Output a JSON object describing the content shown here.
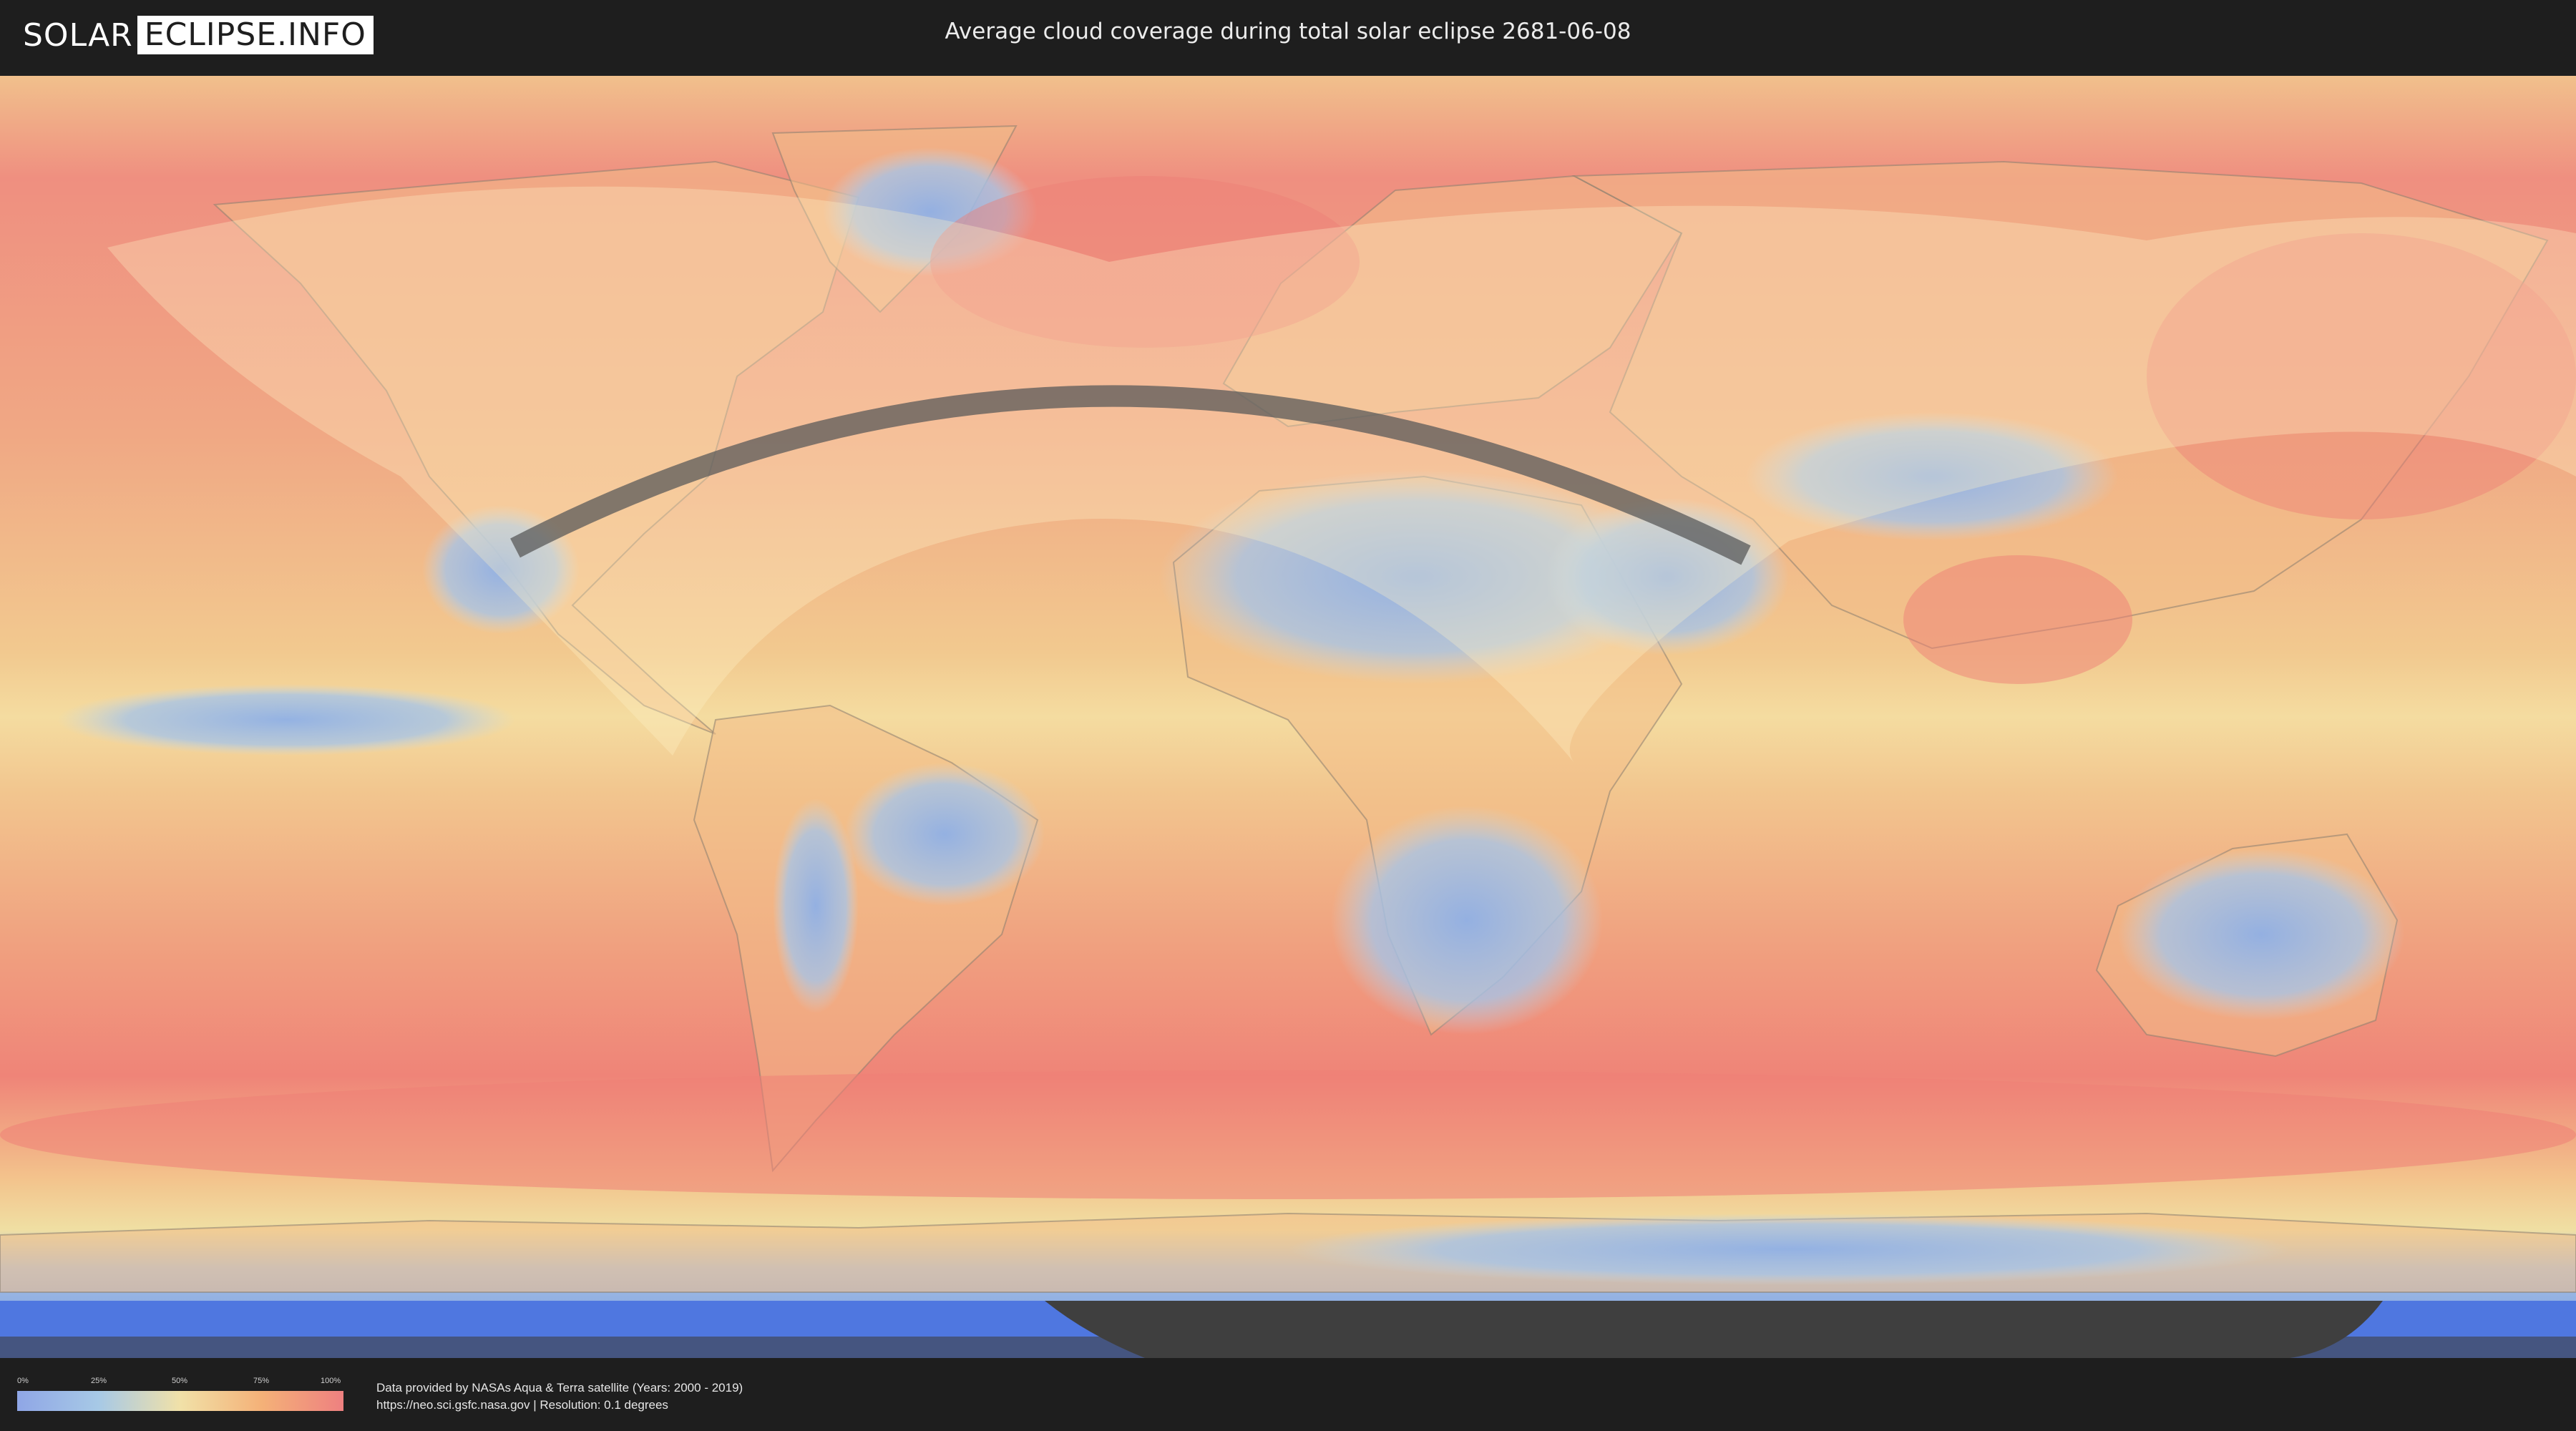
{
  "header": {
    "logo_part1": "SOLAR",
    "logo_part2": "ECLIPSE.INFO",
    "title": "Average cloud coverage during total solar eclipse 2681-06-08"
  },
  "legend": {
    "ticks": [
      "0%",
      "25%",
      "50%",
      "75%",
      "100%"
    ],
    "colors": [
      "#8fa6e6",
      "#a7c9e6",
      "#f1e1a8",
      "#f4b178",
      "#ee8080"
    ]
  },
  "footer": {
    "source_line1": "Data provided by NASAs Aqua & Terra satellite (Years: 2000 - 2019)",
    "source_line2": "https://neo.sci.gsfc.nasa.gov | Resolution: 0.1 degrees"
  },
  "map": {
    "ocean_color": "#ef8c80",
    "clear_color": "#8fb3e6",
    "path_color": "#5a5a5a",
    "shadow_color": "#fff3c8",
    "polar_color": "#4f77e0",
    "no_data_color": "#3a3a3a"
  }
}
